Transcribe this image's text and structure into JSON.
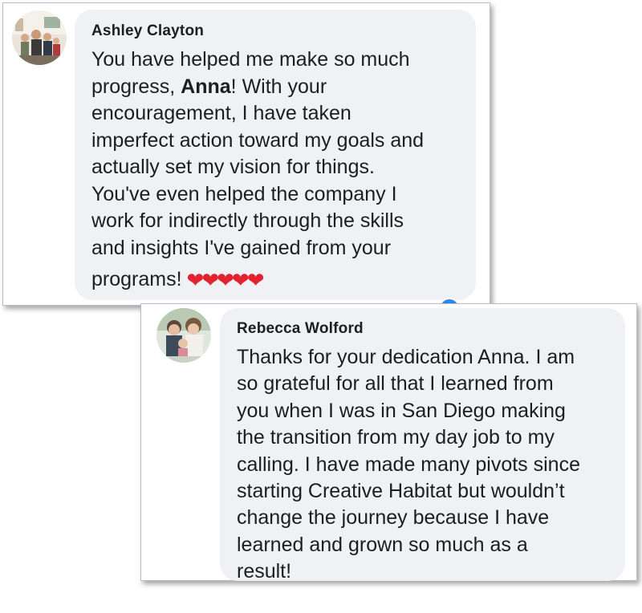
{
  "comments": [
    {
      "author": "Ashley Clayton",
      "lines": [
        "You have helped me make so much",
        "progress, ",
        "actually set my vision for things.",
        "You've even helped the company I",
        "work for indirectly through the skills",
        "and insights I've gained from your",
        "programs!"
      ],
      "line1_bold": "Anna",
      "line1_rest": "! With your",
      "line2": "encouragement, I have taken",
      "line3": "imperfect action toward my goals and",
      "hearts": "❤❤❤❤❤"
    },
    {
      "author": "Rebecca Wolford",
      "lines": [
        "Thanks for your dedication Anna.  I am",
        "so grateful for all that I learned from",
        "you when I was in San Diego making",
        "the transition from my day job to my",
        "calling. I have made many pivots since",
        "starting Creative Habitat but wouldn’t",
        "change the journey because I have",
        "learned and grown so much as a",
        "result!"
      ]
    }
  ]
}
